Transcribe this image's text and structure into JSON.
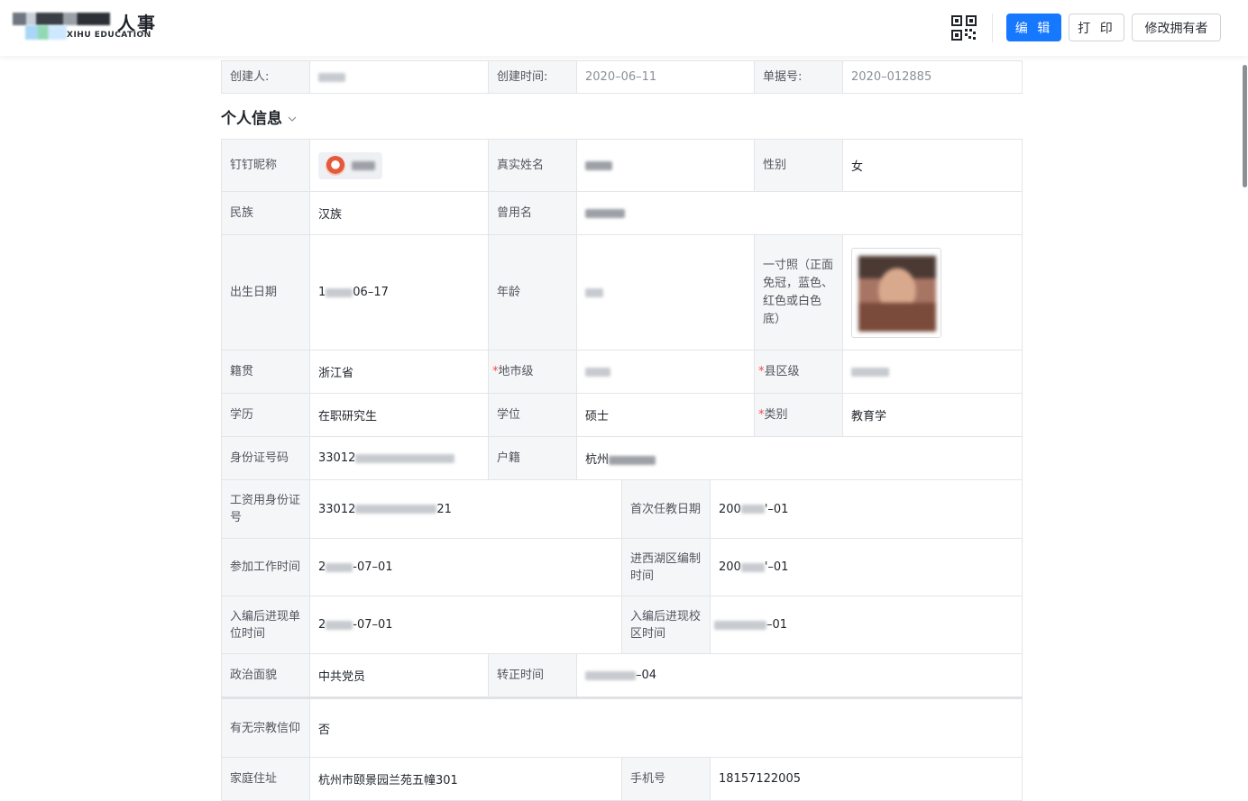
{
  "header": {
    "logo_text": "人事",
    "logo_sub": "XIHU EDUCATION",
    "qr_icon": "qrcode-icon",
    "edit_label": "编 辑",
    "print_label": "打 印",
    "change_owner_label": "修改拥有者",
    "accent_color": "#1677ff"
  },
  "meta": {
    "creator_label": "创建人:",
    "created_time_label": "创建时间:",
    "created_time_value": "2020–06–11",
    "doc_no_label": "单据号:",
    "doc_no_value": "2020–012885"
  },
  "section": {
    "title": "个人信息",
    "chevron_icon": "chevron-down-icon"
  },
  "fields": {
    "dingtalk_nick_label": "钉钉昵称",
    "real_name_label": "真实姓名",
    "gender_label": "性别",
    "gender_value": "女",
    "ethnicity_label": "民族",
    "ethnicity_value": "汉族",
    "former_name_label": "曾用名",
    "birth_label": "出生日期",
    "birth_prefix": "1",
    "birth_suffix": "06–17",
    "age_label": "年龄",
    "photo_label": "一寸照（正面免冠，蓝色、红色或白色底）",
    "native_label": "籍贯",
    "native_value": "浙江省",
    "city_label": "地市级",
    "county_label": "县区级",
    "required_mark": "*",
    "education_label": "学历",
    "education_value": "在职研究生",
    "degree_label": "学位",
    "degree_value": "硕士",
    "category_label": "类别",
    "category_value": "教育学",
    "id_label": "身份证号码",
    "id_prefix": "33012",
    "hukou_label": "户籍",
    "hukou_prefix": "杭州",
    "salary_id_label": "工资用身份证号",
    "salary_id_prefix": "33012",
    "salary_id_suffix": "21",
    "first_teach_label": "首次任教日期",
    "first_teach_prefix": "200",
    "first_teach_suffix": "'–01",
    "work_start_label": "参加工作时间",
    "work_start_prefix": "2",
    "work_start_suffix": "-07–01",
    "xihu_label": "进西湖区编制时间",
    "xihu_prefix": "200",
    "xihu_suffix": "'–01",
    "unit_time_label": "入编后进现单位时间",
    "unit_time_prefix": "2",
    "unit_time_suffix": "-07–01",
    "campus_time_label": "入编后进现校区时间",
    "campus_time_suffix": "–01",
    "politics_label": "政治面貌",
    "politics_value": "中共党员",
    "regular_label": "转正时间",
    "regular_suffix": "–04",
    "religion_label": "有无宗教信仰",
    "religion_value": "否",
    "address_label": "家庭住址",
    "address_value": "杭州市颐景园兰苑五幢301",
    "phone_label": "手机号",
    "phone_value": "18157122005"
  }
}
